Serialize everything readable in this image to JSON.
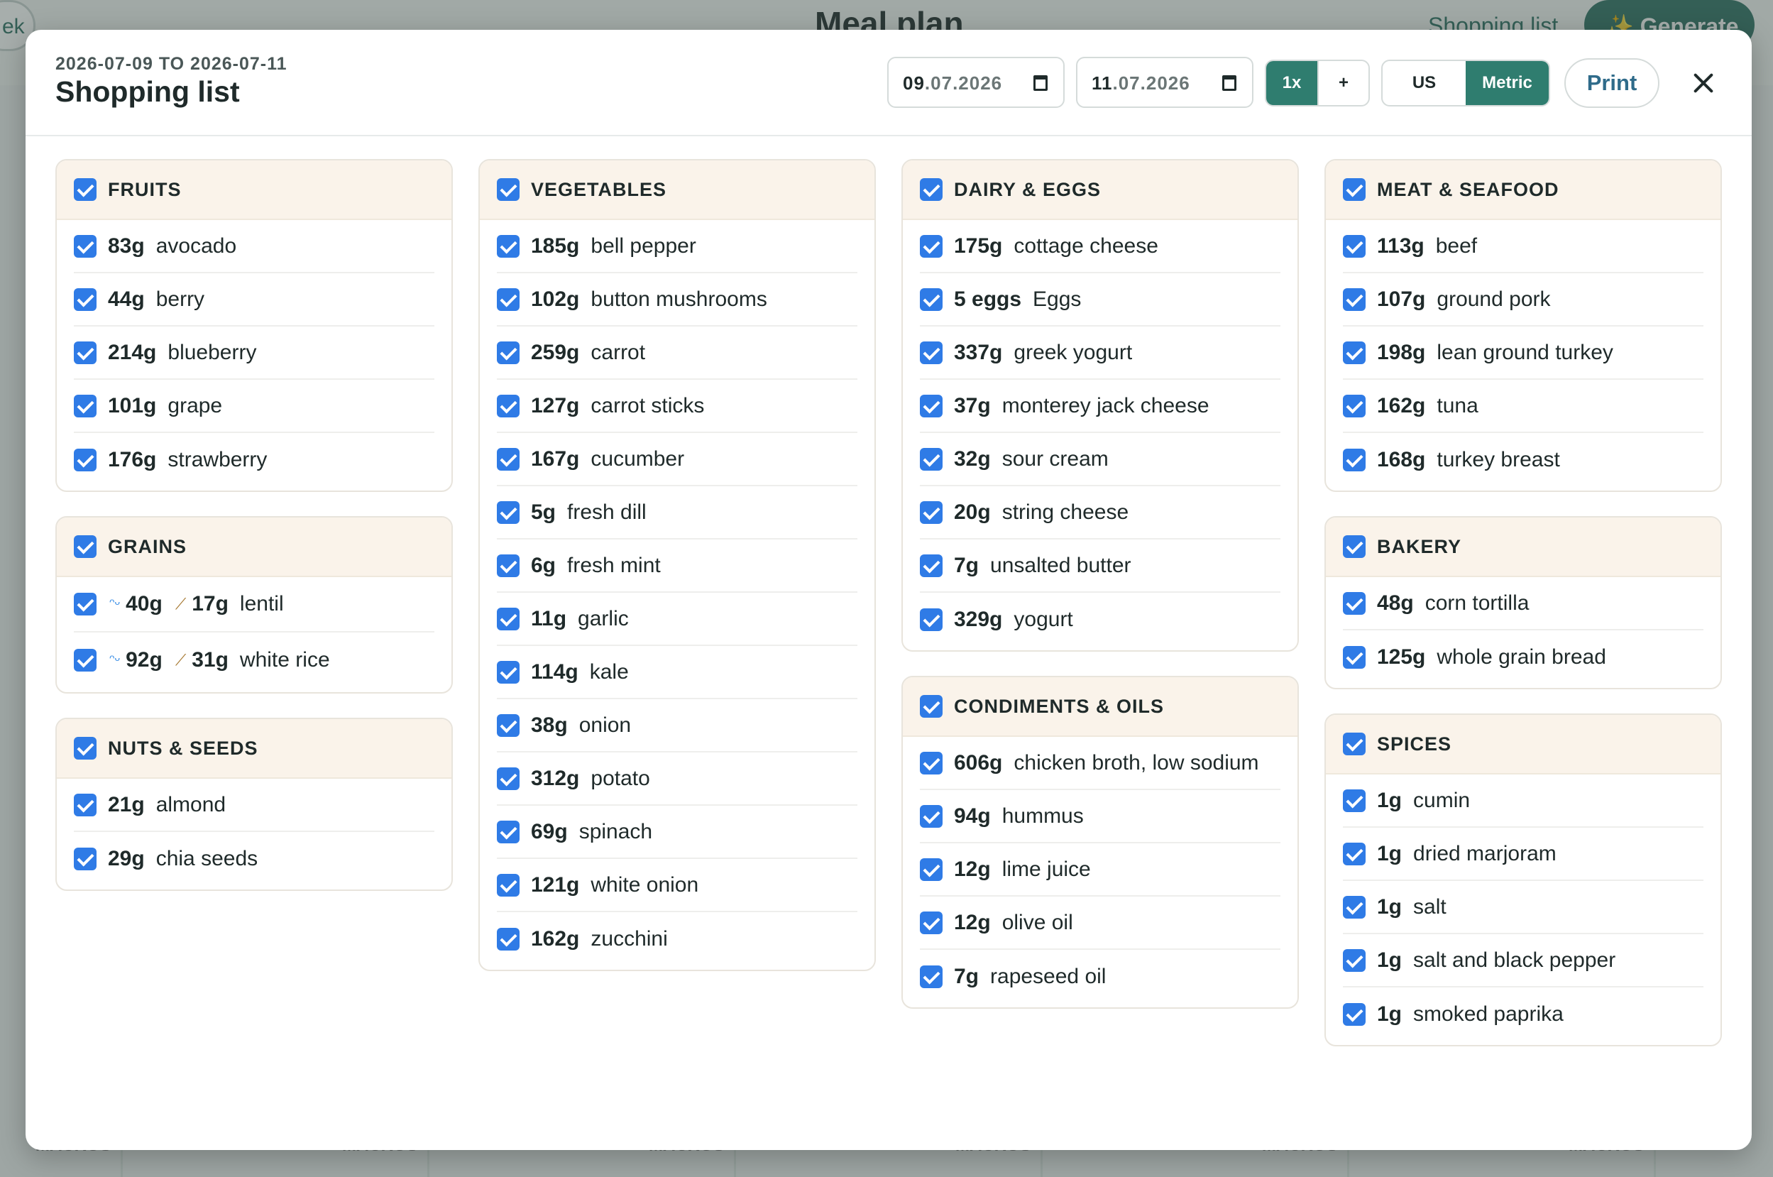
{
  "background": {
    "title": "Meal plan",
    "shopping_link": "Shopping list",
    "generate_button": "Generate",
    "week_button": "ek",
    "macros": [
      "MACROS",
      "MACROS",
      "MACROS",
      "MACROS",
      "MACROS",
      "MACROS"
    ]
  },
  "header": {
    "date_range": "2026-07-09 TO 2026-07-11",
    "title": "Shopping list",
    "start_date": {
      "day_month_prefix": "09",
      "rest": ".07.2026"
    },
    "end_date": {
      "day_month_prefix": "11",
      "rest": ".07.2026"
    },
    "scale": {
      "current": "1x",
      "plus": "+"
    },
    "units": {
      "us": "US",
      "metric": "Metric",
      "selected": "Metric"
    },
    "print_label": "Print"
  },
  "columns": [
    [
      {
        "title": "FRUITS",
        "items": [
          {
            "qty": "83g",
            "name": "avocado"
          },
          {
            "qty": "44g",
            "name": "berry"
          },
          {
            "qty": "214g",
            "name": "blueberry"
          },
          {
            "qty": "101g",
            "name": "grape"
          },
          {
            "qty": "176g",
            "name": "strawberry"
          }
        ]
      },
      {
        "title": "GRAINS",
        "items": [
          {
            "cooked": "40g",
            "dry": "17g",
            "name": "lentil"
          },
          {
            "cooked": "92g",
            "dry": "31g",
            "name": "white rice"
          }
        ]
      },
      {
        "title": "NUTS & SEEDS",
        "items": [
          {
            "qty": "21g",
            "name": "almond"
          },
          {
            "qty": "29g",
            "name": "chia seeds"
          }
        ]
      }
    ],
    [
      {
        "title": "VEGETABLES",
        "items": [
          {
            "qty": "185g",
            "name": "bell pepper"
          },
          {
            "qty": "102g",
            "name": "button mushrooms"
          },
          {
            "qty": "259g",
            "name": "carrot"
          },
          {
            "qty": "127g",
            "name": "carrot sticks"
          },
          {
            "qty": "167g",
            "name": "cucumber"
          },
          {
            "qty": "5g",
            "name": "fresh dill"
          },
          {
            "qty": "6g",
            "name": "fresh mint"
          },
          {
            "qty": "11g",
            "name": "garlic"
          },
          {
            "qty": "114g",
            "name": "kale"
          },
          {
            "qty": "38g",
            "name": "onion"
          },
          {
            "qty": "312g",
            "name": "potato"
          },
          {
            "qty": "69g",
            "name": "spinach"
          },
          {
            "qty": "121g",
            "name": "white onion"
          },
          {
            "qty": "162g",
            "name": "zucchini"
          }
        ]
      }
    ],
    [
      {
        "title": "DAIRY & EGGS",
        "items": [
          {
            "qty": "175g",
            "name": "cottage cheese"
          },
          {
            "qty": "5 eggs",
            "name": "Eggs"
          },
          {
            "qty": "337g",
            "name": "greek yogurt"
          },
          {
            "qty": "37g",
            "name": "monterey jack cheese"
          },
          {
            "qty": "32g",
            "name": "sour cream"
          },
          {
            "qty": "20g",
            "name": "string cheese"
          },
          {
            "qty": "7g",
            "name": "unsalted butter"
          },
          {
            "qty": "329g",
            "name": "yogurt"
          }
        ]
      },
      {
        "title": "CONDIMENTS & OILS",
        "items": [
          {
            "qty": "606g",
            "name": "chicken broth, low sodium"
          },
          {
            "qty": "94g",
            "name": "hummus"
          },
          {
            "qty": "12g",
            "name": "lime juice"
          },
          {
            "qty": "12g",
            "name": "olive oil"
          },
          {
            "qty": "7g",
            "name": "rapeseed oil"
          }
        ]
      }
    ],
    [
      {
        "title": "MEAT & SEAFOOD",
        "items": [
          {
            "qty": "113g",
            "name": "beef"
          },
          {
            "qty": "107g",
            "name": "ground pork"
          },
          {
            "qty": "198g",
            "name": "lean ground turkey"
          },
          {
            "qty": "162g",
            "name": "tuna"
          },
          {
            "qty": "168g",
            "name": "turkey breast"
          }
        ]
      },
      {
        "title": "BAKERY",
        "items": [
          {
            "qty": "48g",
            "name": "corn tortilla"
          },
          {
            "qty": "125g",
            "name": "whole grain bread"
          }
        ]
      },
      {
        "title": "SPICES",
        "items": [
          {
            "qty": "1g",
            "name": "cumin"
          },
          {
            "qty": "1g",
            "name": "dried marjoram"
          },
          {
            "qty": "1g",
            "name": "salt"
          },
          {
            "qty": "1g",
            "name": "salt and black pepper"
          },
          {
            "qty": "1g",
            "name": "smoked paprika"
          }
        ]
      }
    ]
  ],
  "colors": {
    "checkbox": "#2f7be6",
    "accent": "#2f7d6f",
    "card_header": "#faf3ea",
    "print_text": "#2f6b8a"
  },
  "icons": {
    "checkbox": "checkbox-checked-icon",
    "cooked": "water-drop-icon",
    "dry": "grain-icon",
    "close": "close-icon",
    "calendar": "calendar-icon"
  }
}
